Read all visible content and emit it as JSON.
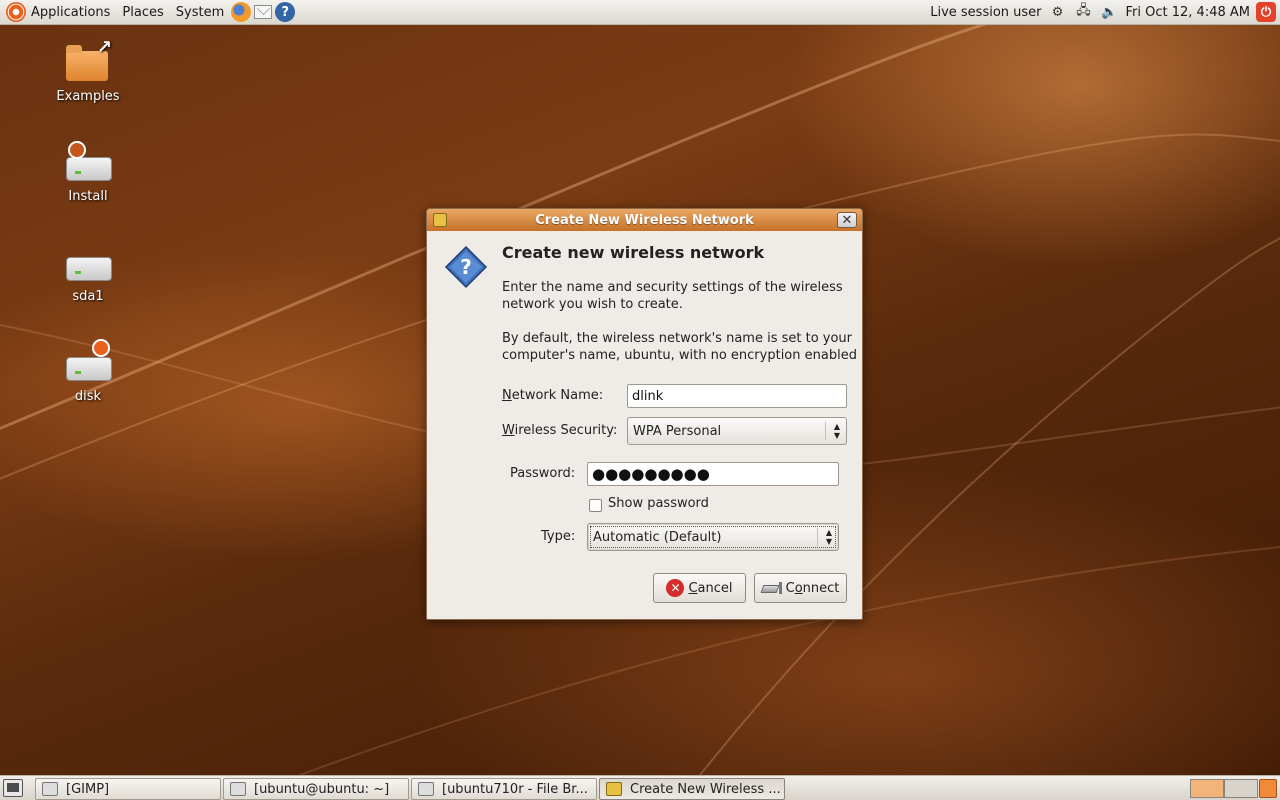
{
  "top_panel": {
    "applications": "Applications",
    "places": "Places",
    "system": "System",
    "user": "Live session user",
    "datetime": "Fri Oct 12,  4:48 AM"
  },
  "desktop_icons": [
    {
      "label": "Examples"
    },
    {
      "label": "Install"
    },
    {
      "label": "sda1"
    },
    {
      "label": "disk"
    }
  ],
  "dialog": {
    "window_title": "Create New Wireless Network",
    "heading": "Create new wireless network",
    "description1": "Enter the name and security settings of the wireless network you wish to create.",
    "description2": "By default, the wireless network's name is set to your computer's name, ubuntu, with no encryption enabled",
    "network_name_label_u": "N",
    "network_name_label_rest": "etwork Name:",
    "network_name_value": "dlink",
    "security_label_u": "W",
    "security_label_rest": "ireless Security:",
    "security_value": "WPA Personal",
    "password_label": "Password:",
    "password_value": "●●●●●●●●●",
    "show_password_label": "Show password",
    "show_password_checked": false,
    "type_label": "Type:",
    "type_value": "Automatic (Default)",
    "cancel_u": "C",
    "cancel_rest": "ancel",
    "connect_u": "o",
    "connect_pre": "C",
    "connect_rest": "nnect"
  },
  "taskbar": [
    {
      "label": "[GIMP]"
    },
    {
      "label": "[ubuntu@ubuntu: ~]"
    },
    {
      "label": "[ubuntu710r - File Br..."
    },
    {
      "label": "Create New Wireless ..."
    }
  ]
}
